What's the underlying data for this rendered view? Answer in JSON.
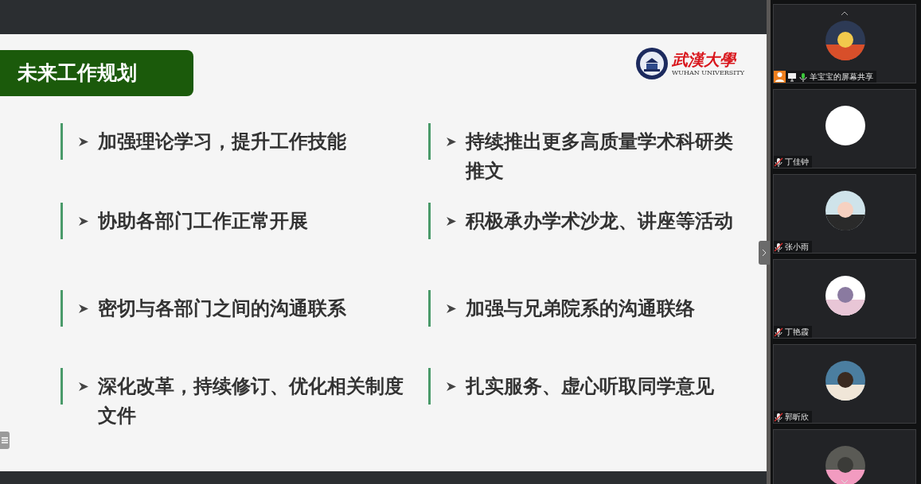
{
  "slide": {
    "title": "未来工作规划",
    "logo": {
      "name_cn": "武漢大學",
      "name_en": "WUHAN UNIVERSITY"
    },
    "items": [
      {
        "text": "加强理论学习，提升工作技能"
      },
      {
        "text": "持续推出更多高质量学术科研类推文"
      },
      {
        "text": "协助各部门工作正常开展"
      },
      {
        "text": "积极承办学术沙龙、讲座等活动"
      },
      {
        "text": "密切与各部门之间的沟通联系"
      },
      {
        "text": "加强与兄弟院系的沟通联络"
      },
      {
        "text": "深化改革，持续修订、优化相关制度文件"
      },
      {
        "text": "扎实服务、虚心听取同学意见"
      }
    ]
  },
  "participants": [
    {
      "name": "羊宝宝的屏幕共享",
      "muted": false,
      "host": true,
      "sharing": true,
      "kind": "picture"
    },
    {
      "name": "丁佳钟",
      "muted": true,
      "host": false,
      "sharing": false,
      "kind": "blank"
    },
    {
      "name": "张小雨",
      "muted": true,
      "host": false,
      "sharing": false,
      "kind": "picture"
    },
    {
      "name": "丁艳霞",
      "muted": true,
      "host": false,
      "sharing": false,
      "kind": "picture"
    },
    {
      "name": "郭昕欣",
      "muted": true,
      "host": false,
      "sharing": false,
      "kind": "picture"
    },
    {
      "kind": "picture"
    }
  ]
}
